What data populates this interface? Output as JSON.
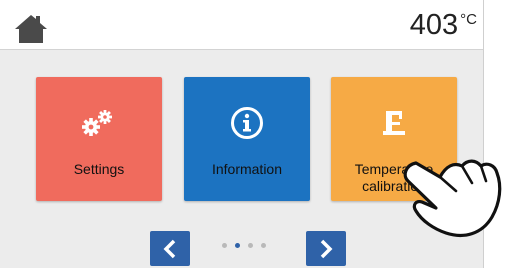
{
  "topbar": {
    "home_icon": "home-icon",
    "temperature": "403",
    "temperature_unit": "°C"
  },
  "tiles": [
    {
      "label": "Settings",
      "icon": "gears-icon",
      "color": "#f06b5d"
    },
    {
      "label": "Information",
      "icon": "info-icon",
      "color": "#1c73c1"
    },
    {
      "label": "Temperature calibration",
      "icon": "calibration-icon",
      "color": "#f6aa45"
    }
  ],
  "pager": {
    "prev_icon": "chevron-left-icon",
    "next_icon": "chevron-right-icon",
    "page_count": 4,
    "active_page": 2
  },
  "colors": {
    "accent": "#2f62a8",
    "background": "#ececec"
  }
}
